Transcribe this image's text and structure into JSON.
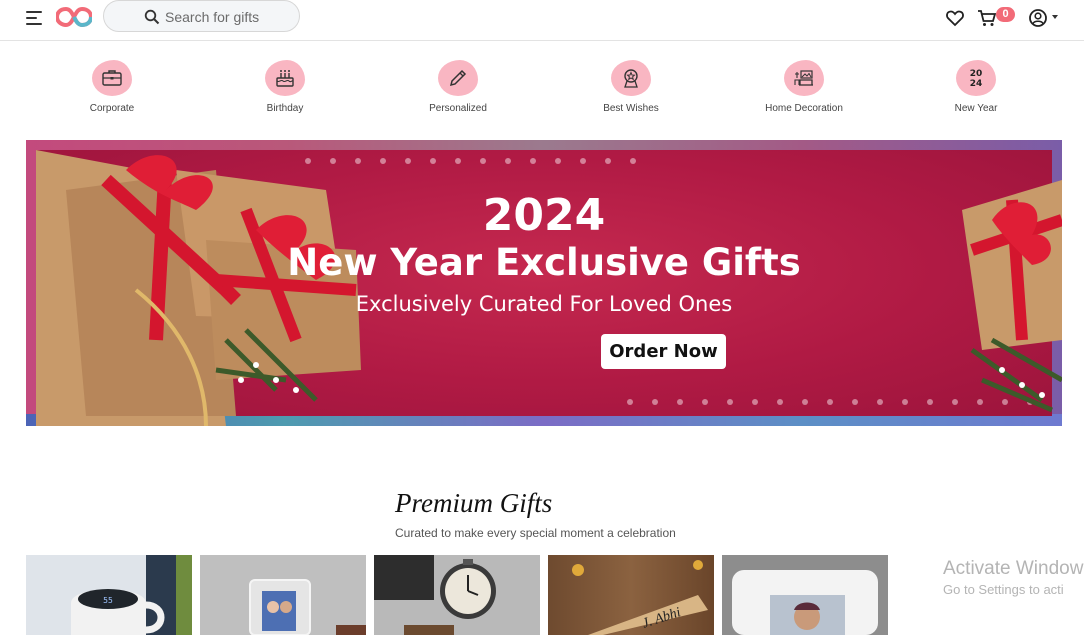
{
  "header": {
    "search_placeholder": "Search for gifts",
    "cart_count": "0"
  },
  "categories": [
    {
      "label": "Corporate",
      "icon": "briefcase-icon"
    },
    {
      "label": "Birthday",
      "icon": "cake-icon"
    },
    {
      "label": "Personalized",
      "icon": "pencil-icon"
    },
    {
      "label": "Best Wishes",
      "icon": "award-icon"
    },
    {
      "label": "Home Decoration",
      "icon": "home-decor-icon"
    },
    {
      "label": "New Year",
      "icon": "2024-icon"
    }
  ],
  "banner": {
    "year": "2024",
    "title": "New Year Exclusive Gifts",
    "subtitle": "Exclusively Curated For Loved Ones",
    "cta": "Order Now"
  },
  "premium": {
    "title": "Premium Gifts",
    "subtitle": "Curated to make every special moment a celebration"
  },
  "products": [
    {
      "name": "smart-mug"
    },
    {
      "name": "acrylic-photo-frame"
    },
    {
      "name": "pocket-watch"
    },
    {
      "name": "wooden-name-plate"
    },
    {
      "name": "photo-cushion"
    }
  ],
  "watermark": {
    "line1": "Activate Window",
    "line2": "Go to Settings to acti"
  },
  "colors": {
    "accent": "#f26b78",
    "category_blob": "#f9b6c2",
    "banner_red": "#b01a44"
  }
}
